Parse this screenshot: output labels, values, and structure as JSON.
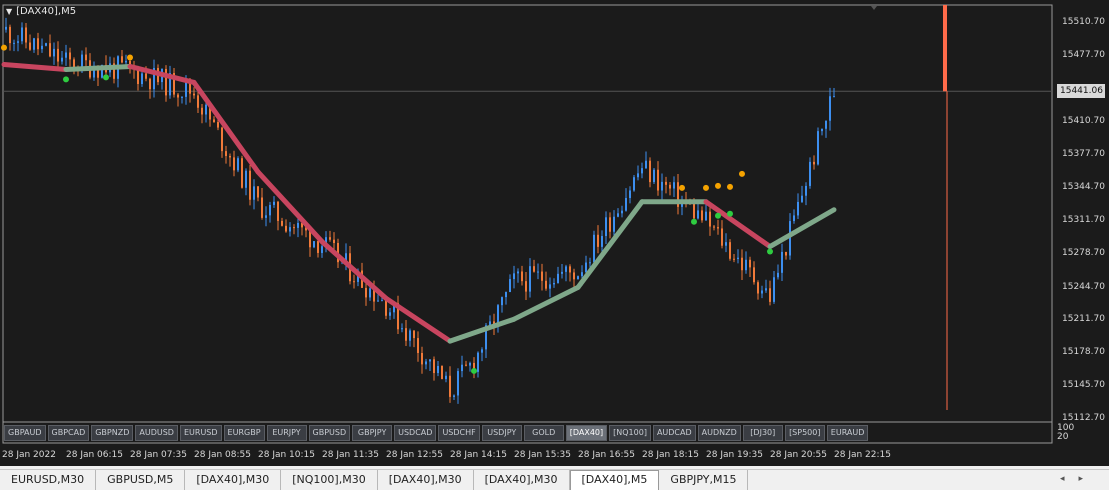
{
  "window": {
    "symbol_title": "[DAX40],M5",
    "current_price": "15441.06"
  },
  "price_axis": {
    "labels": [
      "15510.70",
      "15477.70",
      "15441.06",
      "15410.70",
      "15377.70",
      "15344.70",
      "15311.70",
      "15278.70",
      "15244.70",
      "15211.70",
      "15178.70",
      "15145.70",
      "15112.70"
    ]
  },
  "indicator_axis": {
    "top": "100",
    "bottom": "20"
  },
  "symbol_buttons": [
    {
      "label": "GBPAUD",
      "active": false
    },
    {
      "label": "GBPCAD",
      "active": false
    },
    {
      "label": "GBPNZD",
      "active": false
    },
    {
      "label": "AUDUSD",
      "active": false
    },
    {
      "label": "EURUSD",
      "active": false
    },
    {
      "label": "EURGBP",
      "active": false
    },
    {
      "label": "EURJPY",
      "active": false
    },
    {
      "label": "GBPUSD",
      "active": false
    },
    {
      "label": "GBPJPY",
      "active": false
    },
    {
      "label": "USDCAD",
      "active": false
    },
    {
      "label": "USDCHF",
      "active": false
    },
    {
      "label": "USDJPY",
      "active": false
    },
    {
      "label": "GOLD",
      "active": false
    },
    {
      "label": "[DAX40]",
      "active": true
    },
    {
      "label": "[NQ100]",
      "active": false
    },
    {
      "label": "AUDCAD",
      "active": false
    },
    {
      "label": "AUDNZD",
      "active": false
    },
    {
      "label": "[DJ30]",
      "active": false
    },
    {
      "label": "[SP500]",
      "active": false
    },
    {
      "label": "EURAUD",
      "active": false
    }
  ],
  "time_axis": {
    "labels": [
      "28 Jan 2022",
      "28 Jan 06:15",
      "28 Jan 07:35",
      "28 Jan 08:55",
      "28 Jan 10:15",
      "28 Jan 11:35",
      "28 Jan 12:55",
      "28 Jan 14:15",
      "28 Jan 15:35",
      "28 Jan 16:55",
      "28 Jan 18:15",
      "28 Jan 19:35",
      "28 Jan 20:55",
      "28 Jan 22:15"
    ]
  },
  "tabs": [
    {
      "label": "EURUSD,M30",
      "active": false
    },
    {
      "label": "GBPUSD,M5",
      "active": false
    },
    {
      "label": "[DAX40],M30",
      "active": false
    },
    {
      "label": "[NQ100],M30",
      "active": false
    },
    {
      "label": "[DAX40],M30",
      "active": false
    },
    {
      "label": "[DAX40],M30",
      "active": false
    },
    {
      "label": "[DAX40],M5",
      "active": true
    },
    {
      "label": "GBPJPY,M15",
      "active": false
    }
  ],
  "colors": {
    "background": "#1b1b1b",
    "bull_candle": "#3d8ff0",
    "bear_candle": "#f07a3a",
    "ma_down": "#c8455f",
    "ma_up": "#7fa88a",
    "sell_dot": "#f5a300",
    "buy_dot": "#2ecc40",
    "signal_bar": "#ff6b4a"
  },
  "chart_data": {
    "type": "candlestick",
    "symbol": "[DAX40]",
    "timeframe": "M5",
    "y_range": [
      15112.7,
      15515
    ],
    "x_range": [
      "28 Jan 2022",
      "28 Jan 22:15"
    ],
    "close_path": {
      "x": [
        "28 Jan 2022",
        "28 Jan 06:15",
        "28 Jan 07:35",
        "28 Jan 08:55",
        "28 Jan 10:15",
        "28 Jan 11:35",
        "28 Jan 12:55",
        "28 Jan 14:15",
        "28 Jan 14:45",
        "28 Jan 15:35",
        "28 Jan 16:55",
        "28 Jan 18:15",
        "28 Jan 19:35",
        "28 Jan 20:55",
        "28 Jan 22:15"
      ],
      "y": [
        15503,
        15470,
        15462,
        15440,
        15328,
        15288,
        15228,
        15140,
        15170,
        15250,
        15260,
        15365,
        15310,
        15235,
        15441
      ]
    },
    "moving_average": {
      "x": [
        "28 Jan 2022",
        "28 Jan 06:15",
        "28 Jan 07:35",
        "28 Jan 08:55",
        "28 Jan 10:15",
        "28 Jan 11:35",
        "28 Jan 12:55",
        "28 Jan 14:15",
        "28 Jan 15:35",
        "28 Jan 16:55",
        "28 Jan 18:15",
        "28 Jan 19:35",
        "28 Jan 20:55",
        "28 Jan 22:15"
      ],
      "y": [
        15468,
        15463,
        15466,
        15450,
        15360,
        15290,
        15233,
        15190,
        15212,
        15244,
        15330,
        15330,
        15285,
        15322
      ]
    },
    "sell_signals": {
      "x": [
        "28 Jan 2022",
        "28 Jan 07:35",
        "28 Jan 19:05",
        "28 Jan 19:35",
        "28 Jan 19:50",
        "28 Jan 20:05",
        "28 Jan 20:20"
      ],
      "y": [
        15485,
        15475,
        15344,
        15344,
        15346,
        15345,
        15358
      ]
    },
    "buy_signals": {
      "x": [
        "28 Jan 06:15",
        "28 Jan 07:05",
        "28 Jan 14:45",
        "28 Jan 19:20",
        "28 Jan 19:50",
        "28 Jan 20:05",
        "28 Jan 20:55"
      ],
      "y": [
        15453,
        15455,
        15160,
        15310,
        15316,
        15318,
        15280
      ]
    }
  }
}
